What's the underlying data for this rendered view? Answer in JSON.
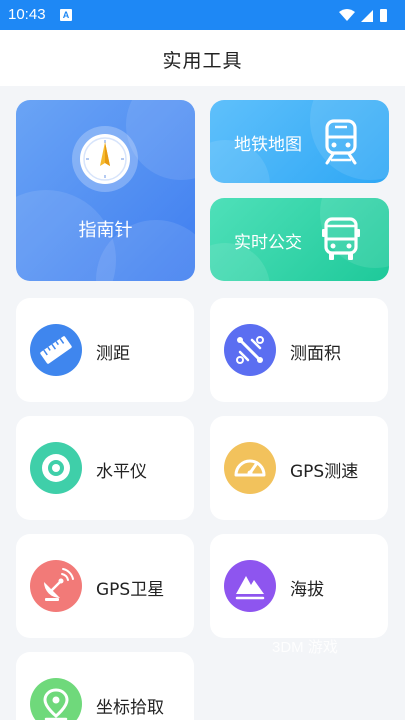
{
  "status": {
    "time": "10:43",
    "notification_badge": "A",
    "bar_color": "#1e88f5"
  },
  "header": {
    "title": "实用工具"
  },
  "top_cards": {
    "compass": {
      "label": "指南针",
      "icon": "compass-icon",
      "color": "#4a86f2"
    },
    "metro": {
      "label": "地铁地图",
      "icon": "train-icon",
      "color": "#3aaef7"
    },
    "bus": {
      "label": "实时公交",
      "icon": "bus-icon",
      "color": "#27d1a4"
    }
  },
  "tools": [
    {
      "label": "测距",
      "icon": "ruler-icon",
      "color": "#3f86ee"
    },
    {
      "label": "测面积",
      "icon": "area-measure-icon",
      "color": "#5b6ef1"
    },
    {
      "label": "水平仪",
      "icon": "level-icon",
      "color": "#3fcfa9"
    },
    {
      "label": "GPS测速",
      "icon": "speedometer-icon",
      "color": "#f2c25c"
    },
    {
      "label": "GPS卫星",
      "icon": "satellite-dish-icon",
      "color": "#f27a78"
    },
    {
      "label": "海拔",
      "icon": "mountain-icon",
      "color": "#8e55ef"
    },
    {
      "label": "坐标拾取",
      "icon": "map-pin-icon",
      "color": "#6fd97b"
    }
  ],
  "watermark": "3DM 游戏"
}
